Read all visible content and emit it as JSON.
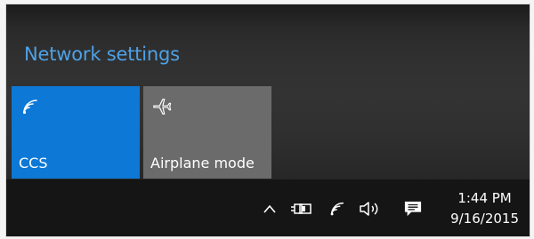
{
  "flyout": {
    "network_settings_label": "Network settings",
    "tiles": [
      {
        "label": "CCS",
        "icon": "wifi-icon",
        "state": "on",
        "color": "#0d78d6"
      },
      {
        "label": "Airplane mode",
        "icon": "airplane-icon",
        "state": "off",
        "color": "#6b6b6b"
      }
    ],
    "accent": "#4ea1e6"
  },
  "taskbar": {
    "tray_icons": [
      "show-hidden-icons-chevron",
      "battery-plug-icon",
      "wifi-icon",
      "volume-icon",
      "action-center-icon"
    ],
    "time": "1:44 PM",
    "date": "9/16/2015"
  }
}
